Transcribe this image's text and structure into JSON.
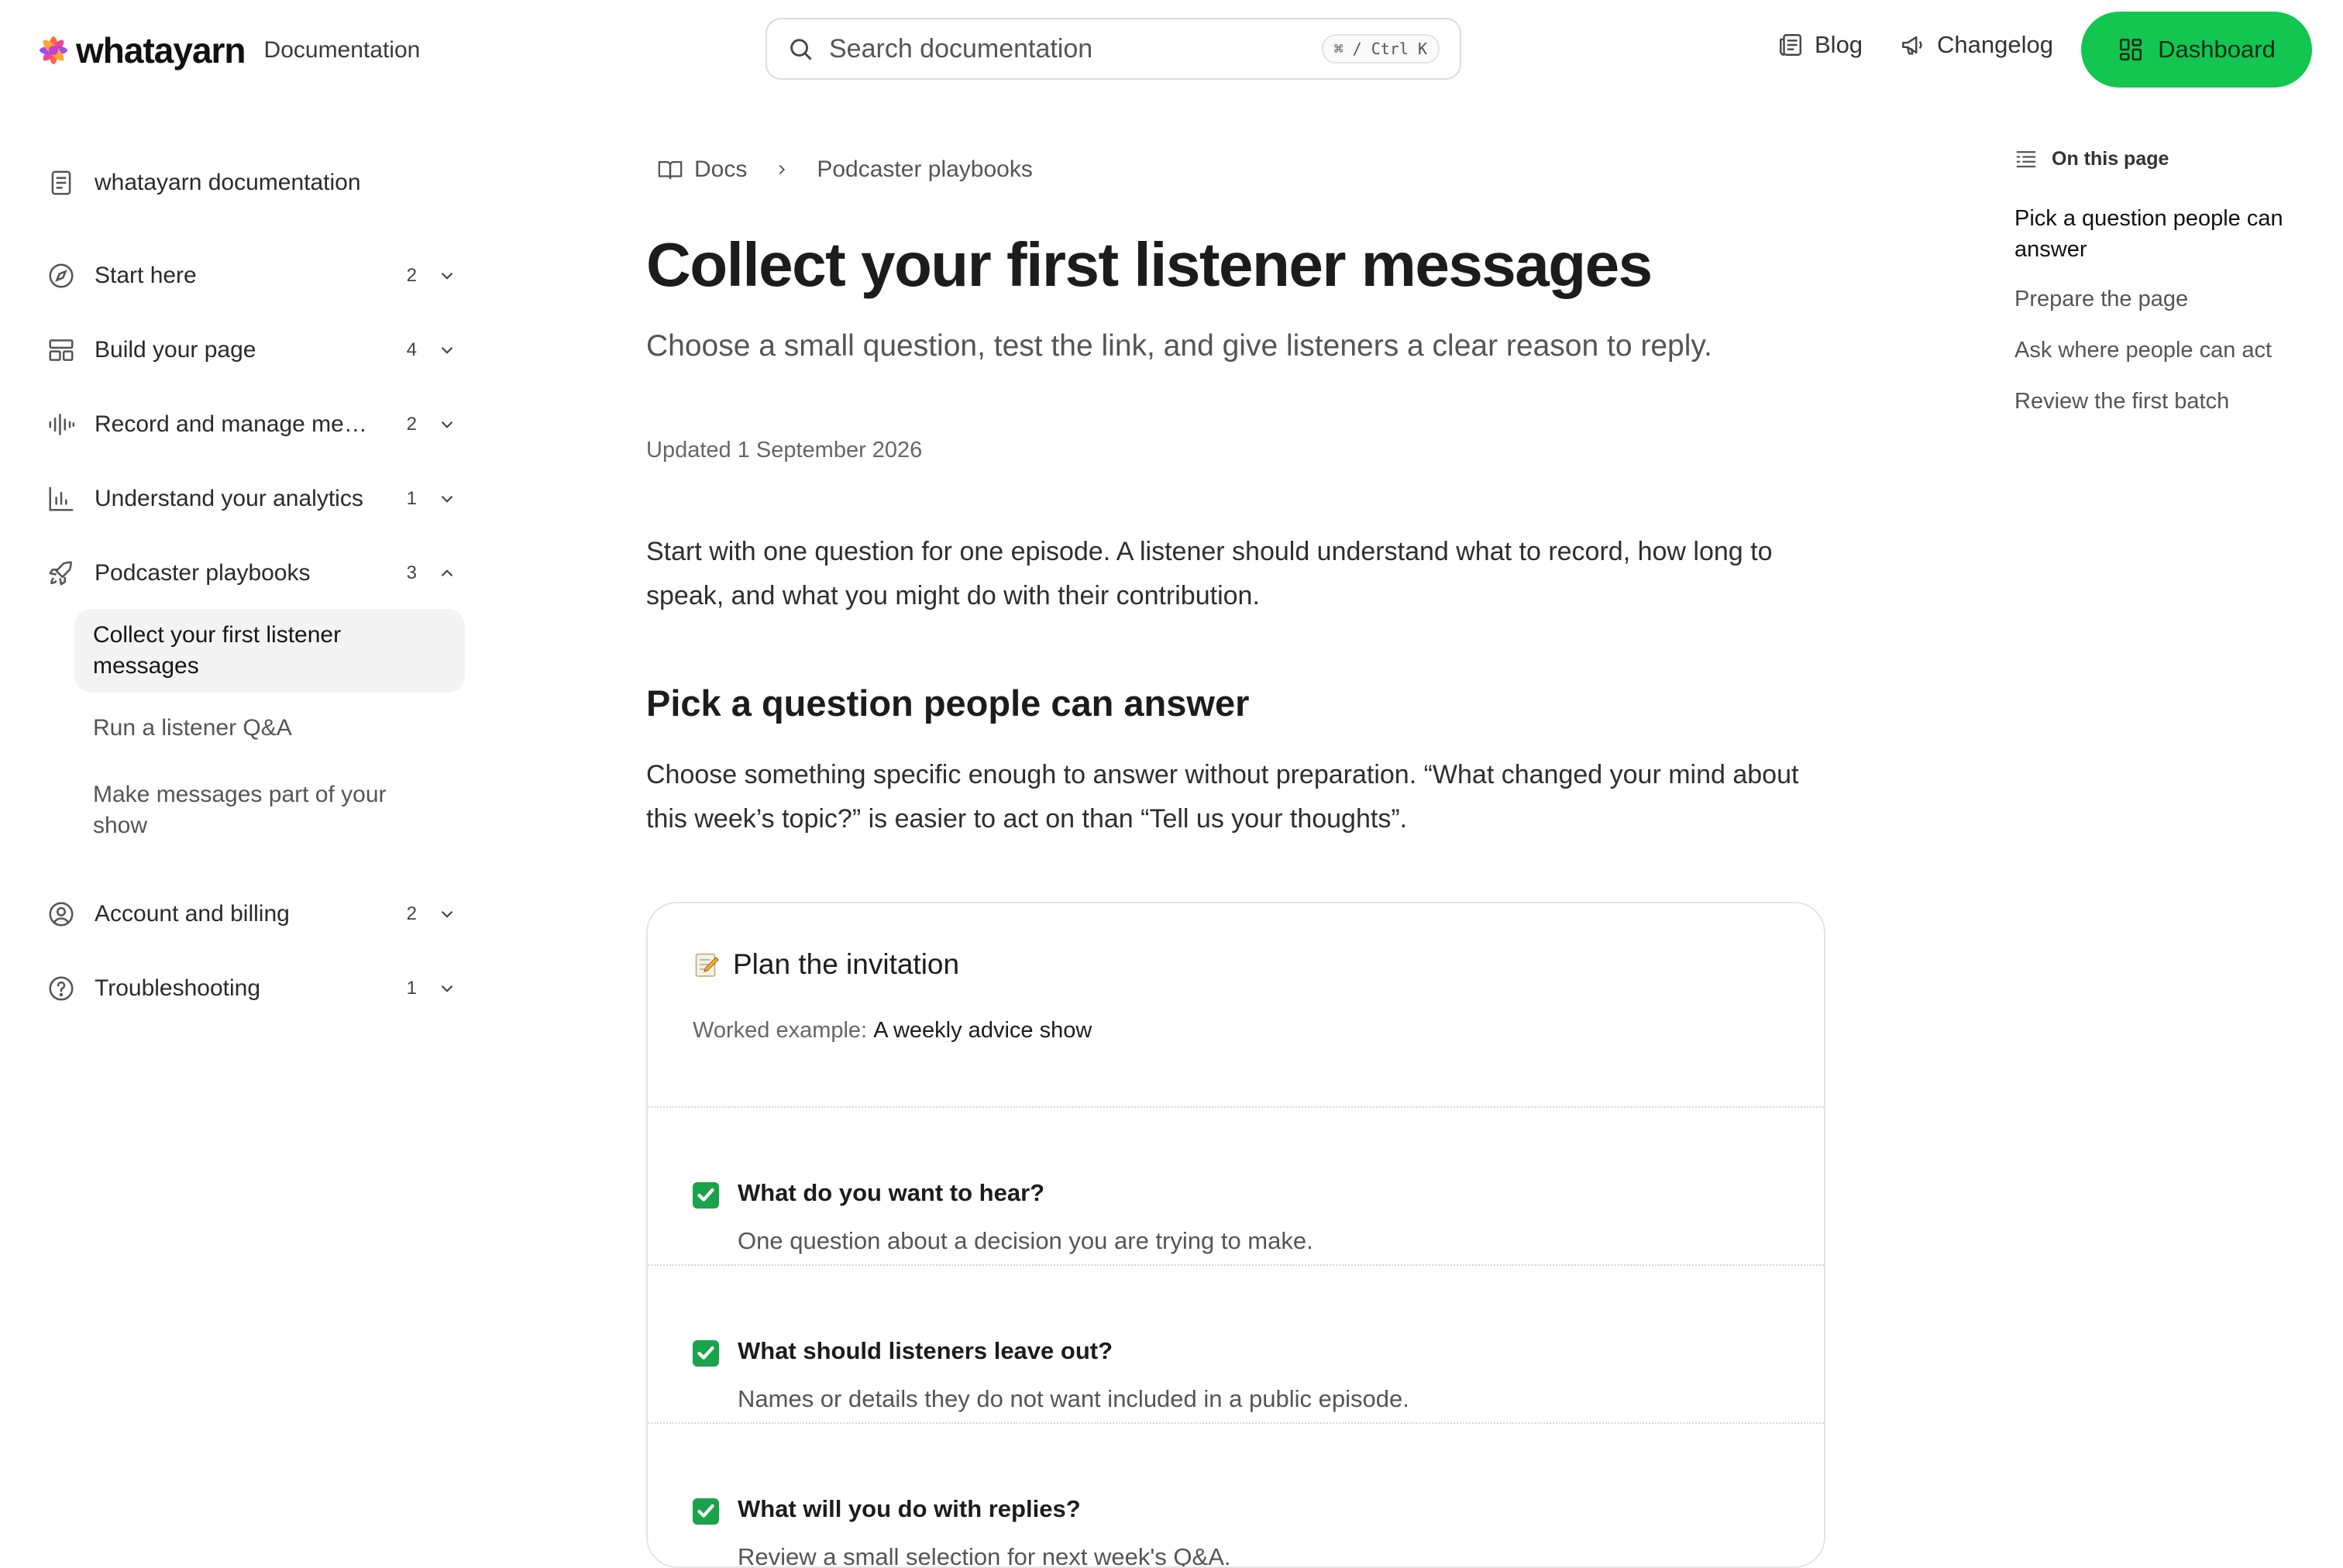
{
  "header": {
    "brand": "whatayarn",
    "section": "Documentation",
    "search": {
      "placeholder": "Search documentation",
      "shortcut": "⌘ / Ctrl K"
    },
    "links": [
      {
        "label": "Blog",
        "icon": "newspaper-icon"
      },
      {
        "label": "Changelog",
        "icon": "megaphone-icon"
      }
    ],
    "cta": {
      "label": "Dashboard",
      "icon": "grid-icon",
      "color": "#12c650"
    }
  },
  "sidebar": {
    "home": {
      "label": "whatayarn documentation",
      "icon": "document-icon"
    },
    "groups": [
      {
        "label": "Start here",
        "count": "2",
        "icon": "compass-icon",
        "expanded": false
      },
      {
        "label": "Build your page",
        "count": "4",
        "icon": "layout-icon",
        "expanded": false
      },
      {
        "label": "Record and manage me…",
        "count": "2",
        "icon": "waveform-icon",
        "expanded": false
      },
      {
        "label": "Understand your analytics",
        "count": "1",
        "icon": "bar-chart-icon",
        "expanded": false
      },
      {
        "label": "Podcaster playbooks",
        "count": "3",
        "icon": "rocket-icon",
        "expanded": true
      },
      {
        "label": "Account and billing",
        "count": "2",
        "icon": "user-circle-icon",
        "expanded": false
      },
      {
        "label": "Troubleshooting",
        "count": "1",
        "icon": "help-circle-icon",
        "expanded": false
      }
    ],
    "playbooks": [
      {
        "label": "Collect your first listener messages",
        "active": true
      },
      {
        "label": "Run a listener Q&A",
        "active": false
      },
      {
        "label": "Make messages part of your show",
        "active": false
      }
    ]
  },
  "breadcrumb": {
    "root": "Docs",
    "current": "Podcaster playbooks"
  },
  "article": {
    "title": "Collect your first listener messages",
    "subtitle": "Choose a small question, test the link, and give listeners a clear reason to reply.",
    "updated": "Updated 1 September 2026",
    "intro": "Start with one question for one episode. A listener should understand what to record, how long to speak, and what you might do with their contribution.",
    "section1_title": "Pick a question people can answer",
    "section1_body": "Choose something specific enough to answer without preparation. “What changed your mind about this week’s topic?” is easier to act on than “Tell us your thoughts”."
  },
  "card": {
    "title": "Plan the invitation",
    "example_label": "Worked example:",
    "example_value": "A weekly advice show",
    "items": [
      {
        "q": "What do you want to hear?",
        "a": "One question about a decision you are trying to make."
      },
      {
        "q": "What should listeners leave out?",
        "a": "Names or details they do not want included in a public episode."
      },
      {
        "q": "What will you do with replies?",
        "a": "Review a small selection for next week's Q&A."
      }
    ]
  },
  "toc": {
    "heading": "On this page",
    "items": [
      {
        "label": "Pick a question people can answer",
        "active": true
      },
      {
        "label": "Prepare the page",
        "active": false
      },
      {
        "label": "Ask where people can act",
        "active": false
      },
      {
        "label": "Review the first batch",
        "active": false
      }
    ]
  }
}
